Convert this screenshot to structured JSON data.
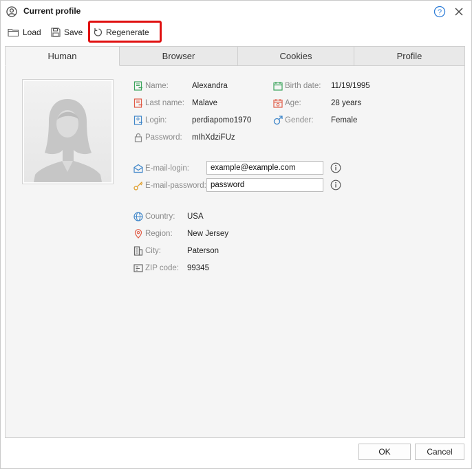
{
  "window": {
    "title": "Current profile"
  },
  "toolbar": {
    "load_label": "Load",
    "save_label": "Save",
    "regenerate_label": "Regenerate"
  },
  "tabs": [
    {
      "label": "Human",
      "active": true
    },
    {
      "label": "Browser",
      "active": false
    },
    {
      "label": "Cookies",
      "active": false
    },
    {
      "label": "Profile",
      "active": false
    }
  ],
  "human": {
    "name": {
      "label": "Name:",
      "value": "Alexandra",
      "icon": "name-card-icon"
    },
    "last_name": {
      "label": "Last name:",
      "value": "Malave",
      "icon": "name-card-icon"
    },
    "login": {
      "label": "Login:",
      "value": "perdiapomo1970",
      "icon": "user-card-icon"
    },
    "password": {
      "label": "Password:",
      "value": "mIhXdziFUz",
      "icon": "lock-icon"
    },
    "birth_date": {
      "label": "Birth date:",
      "value": "11/19/1995",
      "icon": "calendar-icon"
    },
    "age": {
      "label": "Age:",
      "value": "28 years",
      "icon": "calendar-icon"
    },
    "gender": {
      "label": "Gender:",
      "value": "Female",
      "icon": "gender-icon"
    },
    "email_login": {
      "label": "E-mail-login:",
      "value": "example@example.com",
      "icon": "envelope-icon"
    },
    "email_password": {
      "label": "E-mail-password:",
      "value": "password",
      "icon": "key-icon"
    },
    "country": {
      "label": "Country:",
      "value": "USA",
      "icon": "globe-icon"
    },
    "region": {
      "label": "Region:",
      "value": "New Jersey",
      "icon": "map-pin-icon"
    },
    "city": {
      "label": "City:",
      "value": "Paterson",
      "icon": "building-icon"
    },
    "zip": {
      "label": "ZIP code:",
      "value": "99345",
      "icon": "zip-card-icon"
    }
  },
  "footer": {
    "ok_label": "OK",
    "cancel_label": "Cancel"
  },
  "colors": {
    "highlight": "#e01010",
    "green_icon": "#3aa35a",
    "red_icon": "#e05a45",
    "blue_icon": "#3f86c9",
    "orange_icon": "#e0a030"
  }
}
